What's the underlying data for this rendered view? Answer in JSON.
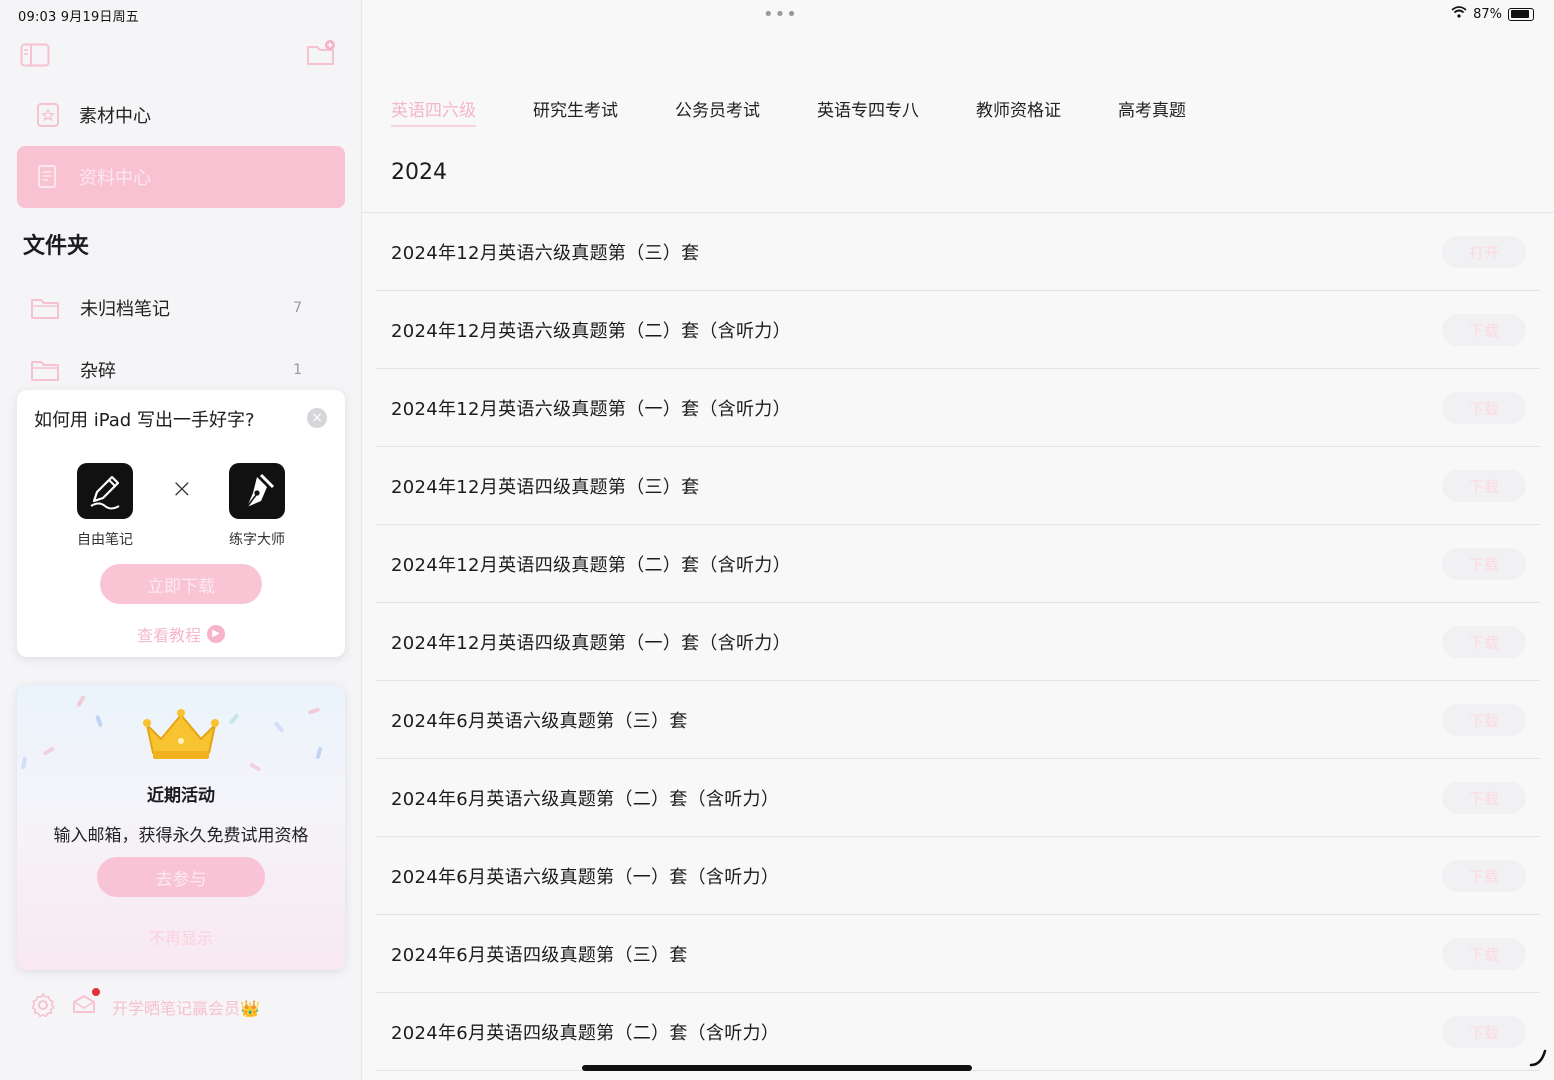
{
  "status_bar": {
    "time_date": "09:03   9月19日周五",
    "more": "•••",
    "battery_percent": "87%",
    "battery_level": 0.87
  },
  "sidebar": {
    "nav": [
      {
        "label": "素材中心",
        "active": false
      },
      {
        "label": "资料中心",
        "active": true
      }
    ],
    "folders_title": "文件夹",
    "folders": [
      {
        "label": "未归档笔记",
        "count": "7"
      },
      {
        "label": "杂碎",
        "count": "1"
      }
    ],
    "promo": {
      "title": "如何用 iPad 写出一手好字?",
      "close": "×",
      "app_left": "自由笔记",
      "times": "×",
      "app_right": "练字大师",
      "download_label": "立即下载",
      "tutorial_label": "查看教程"
    },
    "activity": {
      "title": "近期活动",
      "desc": "输入邮箱，获得永久免费试用资格",
      "join_label": "去参与",
      "dismiss_label": "不再显示"
    },
    "footer_text": "开学晒笔记赢会员👑"
  },
  "main": {
    "tabs": [
      "英语四六级",
      "研究生考试",
      "公务员考试",
      "英语专四专八",
      "教师资格证",
      "高考真题"
    ],
    "active_tab": 0,
    "year": "2024",
    "items": [
      {
        "title": "2024年12月英语六级真题第（三）套",
        "action": "打开"
      },
      {
        "title": "2024年12月英语六级真题第（二）套（含听力）",
        "action": "下载"
      },
      {
        "title": "2024年12月英语六级真题第（一）套（含听力）",
        "action": "下载"
      },
      {
        "title": "2024年12月英语四级真题第（三）套",
        "action": "下载"
      },
      {
        "title": "2024年12月英语四级真题第（二）套（含听力）",
        "action": "下载"
      },
      {
        "title": "2024年12月英语四级真题第（一）套（含听力）",
        "action": "下载"
      },
      {
        "title": "2024年6月英语六级真题第（三）套",
        "action": "下载"
      },
      {
        "title": "2024年6月英语六级真题第（二）套（含听力）",
        "action": "下载"
      },
      {
        "title": "2024年6月英语六级真题第（一）套（含听力）",
        "action": "下载"
      },
      {
        "title": "2024年6月英语四级真题第（三）套",
        "action": "下载"
      },
      {
        "title": "2024年6月英语四级真题第（二）套（含听力）",
        "action": "下载"
      }
    ]
  },
  "colors": {
    "accent_pink": "#f9c2d3",
    "text_primary": "#1c1c1e",
    "divider": "#e3e3e6"
  }
}
